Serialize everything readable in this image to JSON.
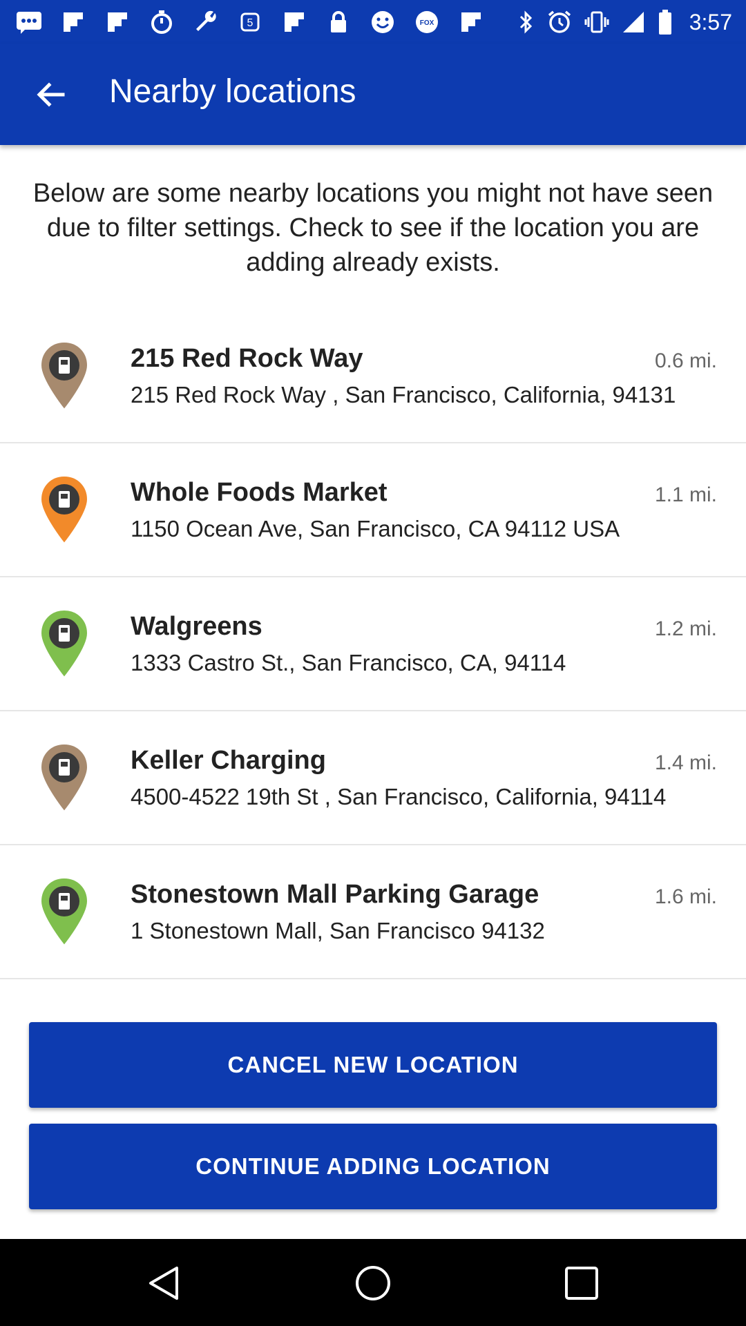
{
  "status_bar": {
    "time": "3:57",
    "icons": [
      "chat-icon",
      "flipboard-icon",
      "flipboard-icon",
      "timer-icon",
      "wrench-icon",
      "square-icon",
      "flipboard-icon",
      "lock-icon",
      "smile-icon",
      "fox-sports-icon",
      "flipboard-icon",
      "bluetooth-icon",
      "alarm-icon",
      "vibrate-icon",
      "signal-icon",
      "battery-icon"
    ]
  },
  "app_bar": {
    "title": "Nearby locations",
    "back_icon": "arrow-back-icon"
  },
  "intro_text": "Below are some nearby locations you might not have seen due to filter settings. Check to see if the location you are adding already exists.",
  "locations": [
    {
      "name": "215 Red Rock Way",
      "address": "215 Red Rock Way , San Francisco, California, 94131",
      "distance": "0.6 mi.",
      "pin_color": "#a78a6e"
    },
    {
      "name": "Whole Foods Market",
      "address": "1150 Ocean Ave, San Francisco, CA 94112 USA",
      "distance": "1.1 mi.",
      "pin_color": "#f28a2a"
    },
    {
      "name": "Walgreens",
      "address": "1333 Castro St., San Francisco, CA, 94114",
      "distance": "1.2 mi.",
      "pin_color": "#7fbf4d"
    },
    {
      "name": "Keller Charging",
      "address": "4500-4522 19th St , San Francisco, California, 94114",
      "distance": "1.4 mi.",
      "pin_color": "#a78a6e"
    },
    {
      "name": "Stonestown Mall Parking Garage",
      "address": "1 Stonestown Mall, San Francisco 94132",
      "distance": "1.6 mi.",
      "pin_color": "#7fbf4d"
    }
  ],
  "buttons": {
    "cancel": "CANCEL NEW LOCATION",
    "continue": "CONTINUE ADDING LOCATION"
  },
  "nav_bar": {
    "back_icon": "nav-back-icon",
    "home_icon": "nav-home-icon",
    "recents_icon": "nav-recents-icon"
  },
  "colors": {
    "primary": "#0d3bb0",
    "text": "#222222",
    "secondary_text": "#666666",
    "divider": "#e6e6e6"
  }
}
